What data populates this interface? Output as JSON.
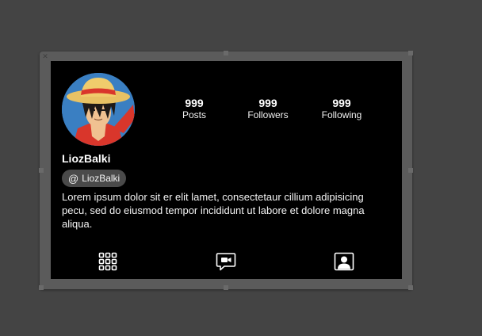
{
  "profile": {
    "username": "LiozBalki",
    "handle": "LiozBalki",
    "handle_icon": "@",
    "bio": "Lorem ipsum dolor sit er elit lamet, consectetaur cillium adipisicing pecu, sed do eiusmod tempor incididunt ut labore et dolore magna aliqua."
  },
  "stats": [
    {
      "value": "999",
      "label": "Posts"
    },
    {
      "value": "999",
      "label": "Followers"
    },
    {
      "value": "999",
      "label": "Following"
    }
  ],
  "tabs": [
    {
      "icon": "grid-icon"
    },
    {
      "icon": "video-chat-icon"
    },
    {
      "icon": "tagged-user-icon"
    }
  ],
  "colors": {
    "desktop_background": "#444444",
    "frame": "#5b5b5b",
    "screen_background": "#000000",
    "badge_background": "#4a4a4a",
    "text": "#ffffff"
  }
}
